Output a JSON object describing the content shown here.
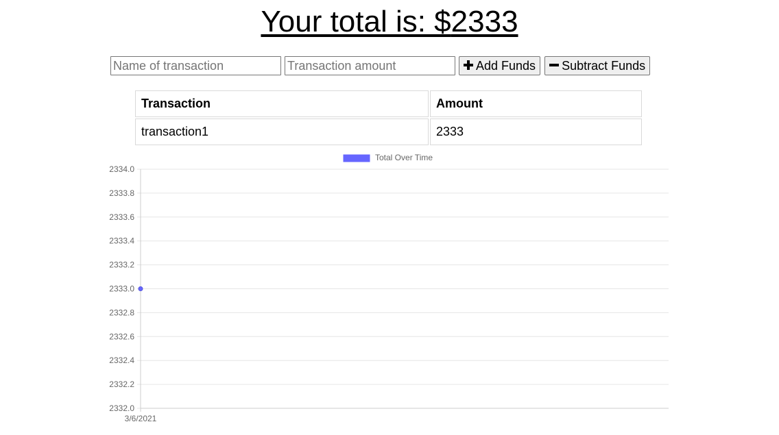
{
  "header": {
    "total_label": "Your total is: $",
    "total_value": "2333"
  },
  "form": {
    "name_placeholder": "Name of transaction",
    "amount_placeholder": "Transaction amount",
    "add_label": "Add Funds",
    "subtract_label": "Subtract Funds",
    "add_icon": "plus-icon",
    "subtract_icon": "minus-icon"
  },
  "table": {
    "headers": [
      "Transaction",
      "Amount"
    ],
    "rows": [
      {
        "name": "transaction1",
        "amount": "2333"
      }
    ]
  },
  "chart_data": {
    "type": "line",
    "title": "",
    "xlabel": "",
    "ylabel": "",
    "legend": "top-center",
    "grid": true,
    "x": [
      "3/6/2021"
    ],
    "series": [
      {
        "name": "Total Over Time",
        "values": [
          2333
        ],
        "color": "#6666ff"
      }
    ],
    "ylim": [
      2332.0,
      2334.0
    ],
    "yticks": [
      "2334.0",
      "2333.8",
      "2333.6",
      "2333.4",
      "2333.2",
      "2333.0",
      "2332.8",
      "2332.6",
      "2332.4",
      "2332.2",
      "2332.0"
    ]
  }
}
